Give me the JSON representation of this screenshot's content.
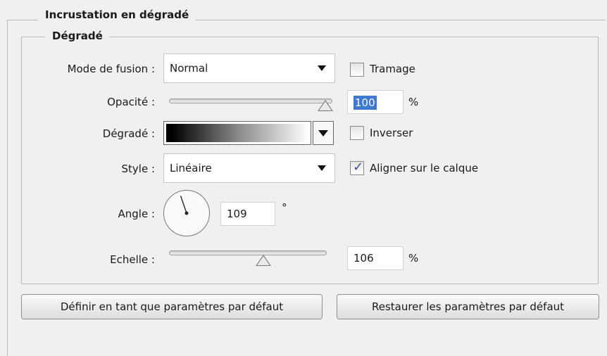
{
  "group": {
    "title": "Incrustation en dégradé",
    "subgroup_title": "Dégradé"
  },
  "blend_mode": {
    "label": "Mode de fusion :",
    "value": "Normal",
    "dither_label": "Tramage",
    "dither_checked": false
  },
  "opacity": {
    "label": "Opacité :",
    "value": "100",
    "unit": "%",
    "level": 1.0
  },
  "gradient": {
    "label": "Dégradé :",
    "reverse_label": "Inverser",
    "reverse_checked": false
  },
  "style": {
    "label": "Style :",
    "value": "Linéaire",
    "align_label": "Aligner sur le calque",
    "align_checked": true
  },
  "angle": {
    "label": "Angle :",
    "value": "109",
    "unit": "°",
    "degrees": 109
  },
  "scale": {
    "label": "Echelle :",
    "value": "106",
    "unit": "%",
    "level": 0.6
  },
  "buttons": {
    "set_default": "Définir en tant que paramètres par défaut",
    "reset_default": "Restaurer les paramètres par défaut"
  }
}
